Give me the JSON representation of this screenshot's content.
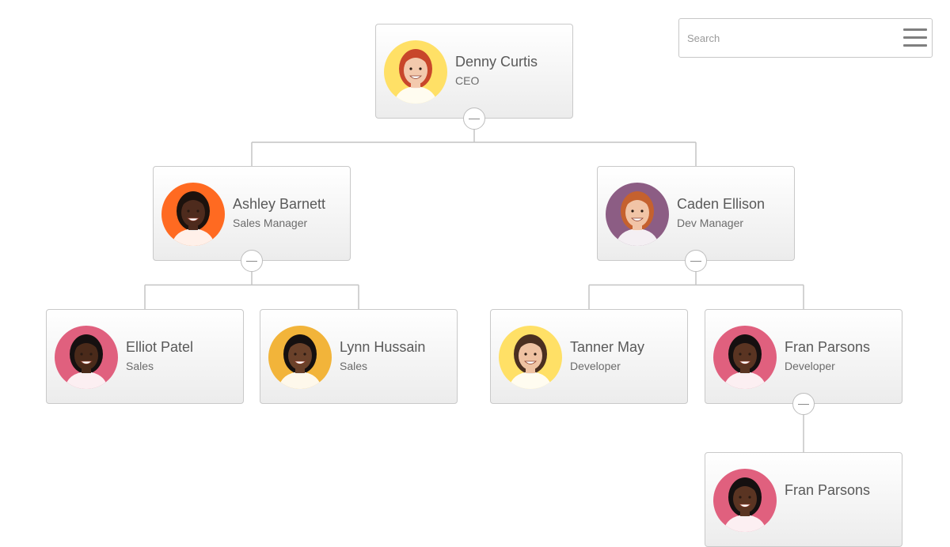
{
  "search": {
    "placeholder": "Search"
  },
  "org_chart": {
    "nodes": [
      {
        "id": "denny",
        "name": "Denny Curtis",
        "title": "CEO",
        "avatar_bg": "#ffe066",
        "skin": "#f3c9ad",
        "hair": "#c8462b"
      },
      {
        "id": "ashley",
        "name": "Ashley Barnett",
        "title": "Sales Manager",
        "avatar_bg": "#ff6a21",
        "skin": "#4e2b1d",
        "hair": "#1c120d"
      },
      {
        "id": "caden",
        "name": "Caden Ellison",
        "title": "Dev Manager",
        "avatar_bg": "#8c5d84",
        "skin": "#f1c4a6",
        "hair": "#c5612e"
      },
      {
        "id": "elliot",
        "name": "Elliot Patel",
        "title": "Sales",
        "avatar_bg": "#e0607e",
        "skin": "#4a2a1a",
        "hair": "#151010"
      },
      {
        "id": "lynn",
        "name": "Lynn Hussain",
        "title": "Sales",
        "avatar_bg": "#f2b43a",
        "skin": "#6a412a",
        "hair": "#151010"
      },
      {
        "id": "tanner",
        "name": "Tanner May",
        "title": "Developer",
        "avatar_bg": "#ffe066",
        "skin": "#efc2a2",
        "hair": "#4a2f20"
      },
      {
        "id": "fran",
        "name": "Fran Parsons",
        "title": "Developer",
        "avatar_bg": "#e0607e",
        "skin": "#5a3422",
        "hair": "#151010"
      },
      {
        "id": "fran2",
        "name": "Fran Parsons",
        "title": "",
        "avatar_bg": "#e0607e",
        "skin": "#5a3422",
        "hair": "#151010"
      }
    ],
    "edges": [
      [
        "denny",
        "ashley"
      ],
      [
        "denny",
        "caden"
      ],
      [
        "ashley",
        "elliot"
      ],
      [
        "ashley",
        "lynn"
      ],
      [
        "caden",
        "tanner"
      ],
      [
        "caden",
        "fran"
      ],
      [
        "fran",
        "fran2"
      ]
    ],
    "collapse_buttons": [
      "denny",
      "ashley",
      "caden",
      "fran"
    ]
  },
  "colors": {
    "line": "#c4c4c4",
    "text": "#595959"
  }
}
